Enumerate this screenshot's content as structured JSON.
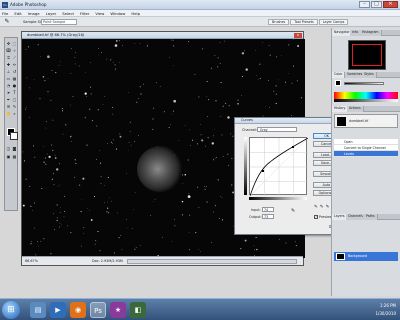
{
  "app": {
    "title": "Adobe Photoshop",
    "logo_text": "Ps"
  },
  "window_buttons": {
    "minimize": "–",
    "maximize": "□",
    "close": "✕"
  },
  "menu": [
    "File",
    "Edit",
    "Image",
    "Layer",
    "Select",
    "Filter",
    "View",
    "Window",
    "Help"
  ],
  "options_bar": {
    "tool_icon": "eyedropper-icon",
    "tool_glyph": "✎",
    "label": "Sample Size:",
    "sample_size": "Point Sample",
    "tabs": [
      "Brushes",
      "Tool Presets",
      "Layer Comps"
    ]
  },
  "document": {
    "title": "dumbbell.tif @ 66.7% (Gray/16)",
    "close": "x",
    "zoom": "66.67%",
    "size": "Doc: 2.93M/2.93M"
  },
  "curves": {
    "title": "Curves",
    "close": "x",
    "channel_label": "Channel:",
    "channel_value": "Gray",
    "input_label": "Input:",
    "input_value": "74",
    "output_label": "Output:",
    "output_value": "73",
    "buttons": [
      "OK",
      "Cancel",
      "Load...",
      "Save...",
      "Smooth",
      "Auto",
      "Options..."
    ],
    "preview_label": "Preview",
    "preview_checked": "✓"
  },
  "panels": {
    "navigator_tabs": [
      "Navigator",
      "Info",
      "Histogram"
    ],
    "color_tabs": [
      "Color",
      "Swatches",
      "Styles"
    ],
    "history_tabs": [
      "History",
      "Actions"
    ],
    "history_items": [
      "dumbbell.tif",
      "Open",
      "Convert to Single Channel",
      "Levels"
    ],
    "layers_tabs": [
      "Layers",
      "Channels",
      "Paths"
    ],
    "layer_name": "Background"
  },
  "taskbar": {
    "start_glyph": "⊞",
    "apps": [
      {
        "name": "explorer",
        "glyph": "▤"
      },
      {
        "name": "media",
        "glyph": "▶"
      },
      {
        "name": "firefox",
        "glyph": "◉"
      },
      {
        "name": "photoshop",
        "glyph": "Ps"
      },
      {
        "name": "maxim",
        "glyph": "★"
      },
      {
        "name": "camera",
        "glyph": "◧"
      }
    ],
    "time": "1:26 PM",
    "date": "1/30/2010"
  },
  "colors": {
    "selection": "#3875d7",
    "taskbar": "#32527c",
    "close_red": "#c9473a"
  }
}
